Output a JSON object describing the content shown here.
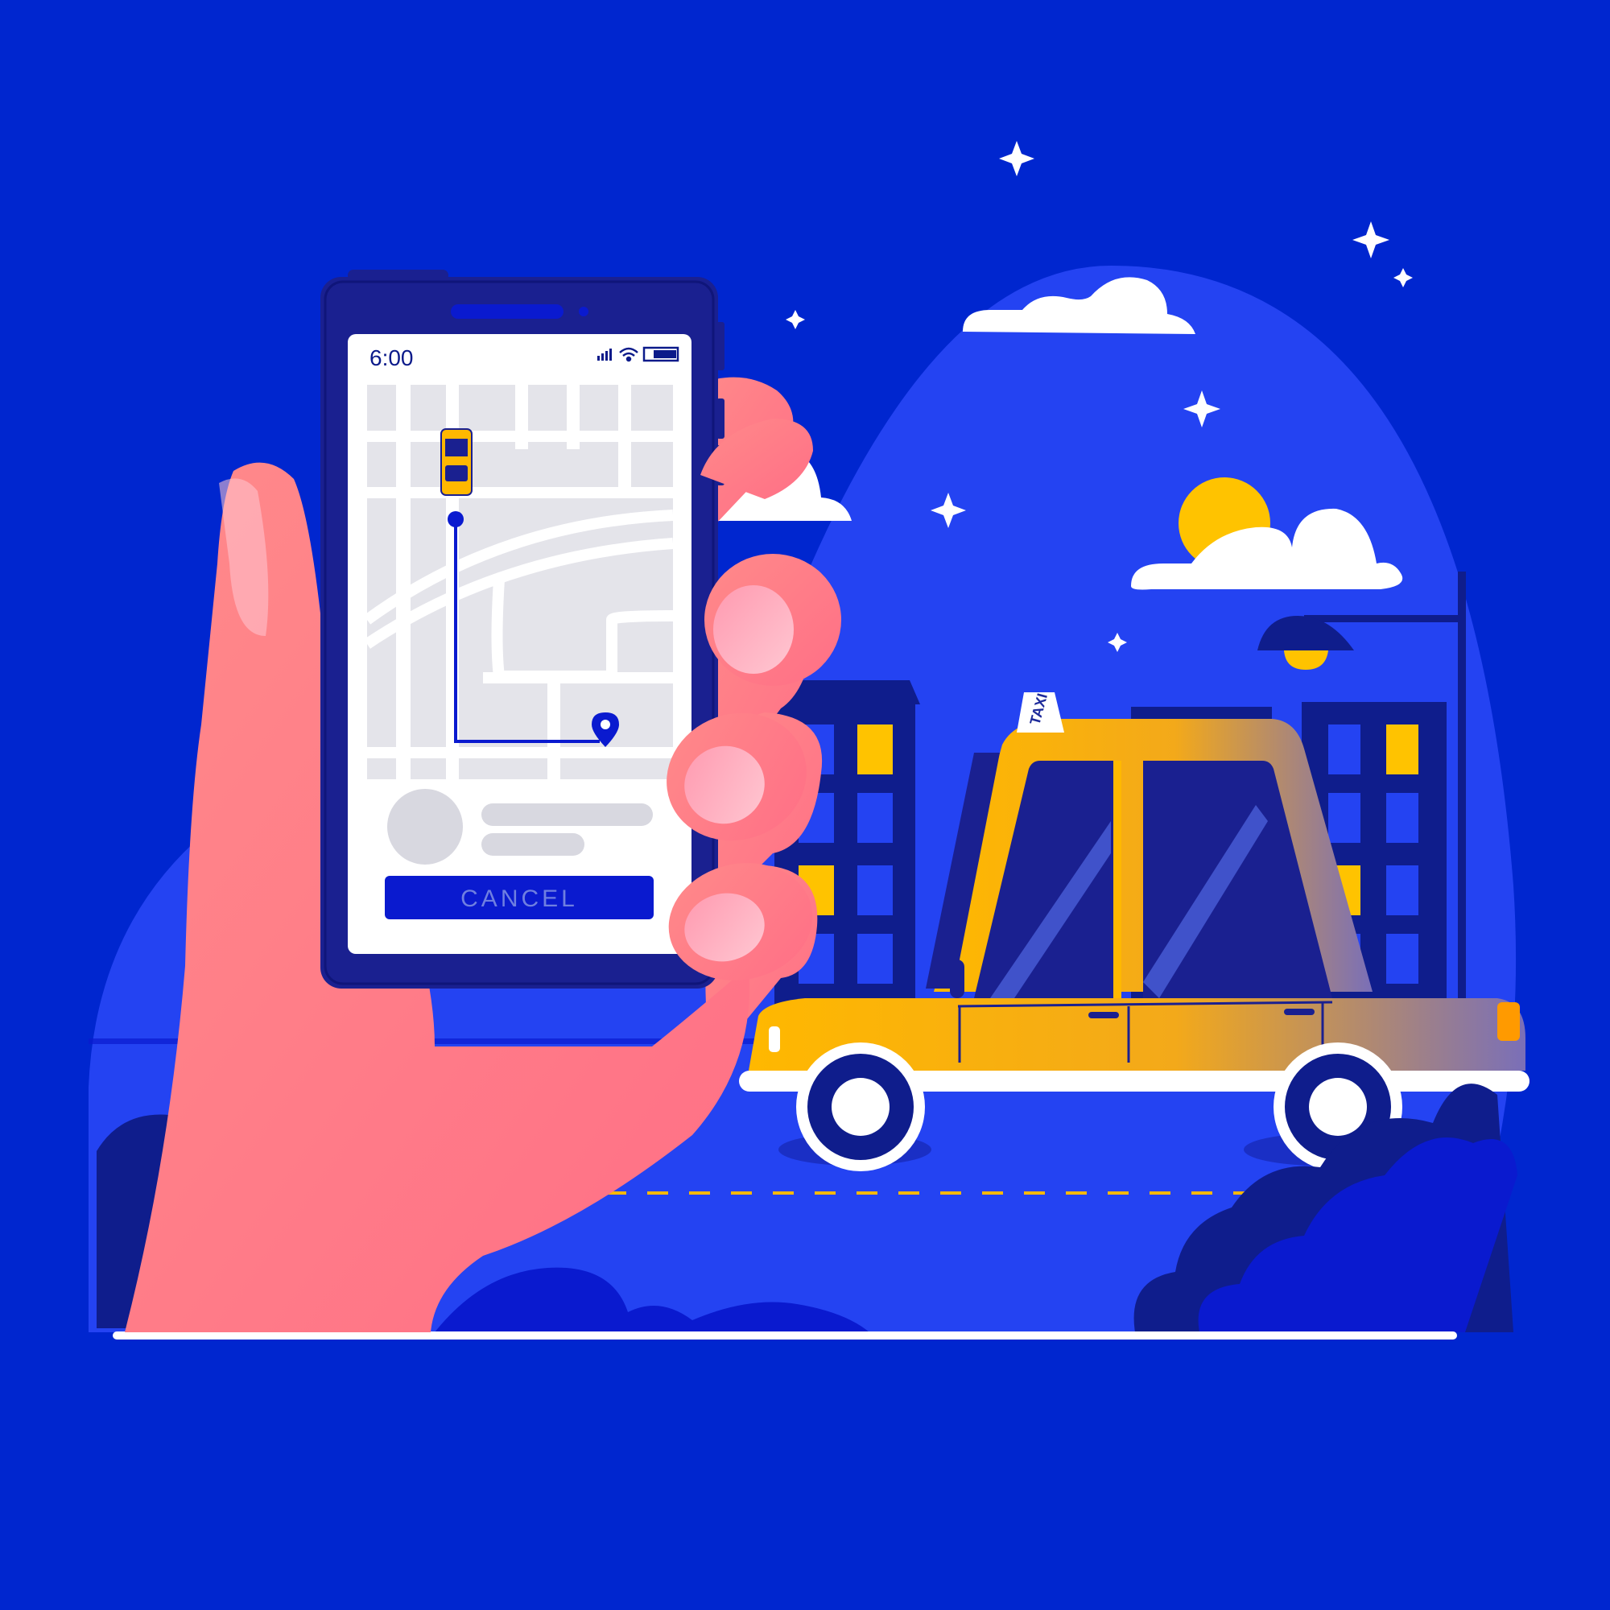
{
  "phone": {
    "status_time": "6:00",
    "cancel_button_label": "CANCEL"
  },
  "taxi": {
    "roof_sign": "TAXI"
  },
  "colors": {
    "background": "#0026cf",
    "sky": "#2443f2",
    "taxi_yellow": "#ffb800",
    "skin": "#ff8a8a",
    "phone_frame": "#1a2090",
    "accent": "#0a1acf"
  },
  "icons": [
    "signal-icon",
    "wifi-icon",
    "battery-icon",
    "location-pin-icon",
    "taxi-map-icon",
    "star-icon",
    "cloud-icon",
    "moon-icon"
  ]
}
